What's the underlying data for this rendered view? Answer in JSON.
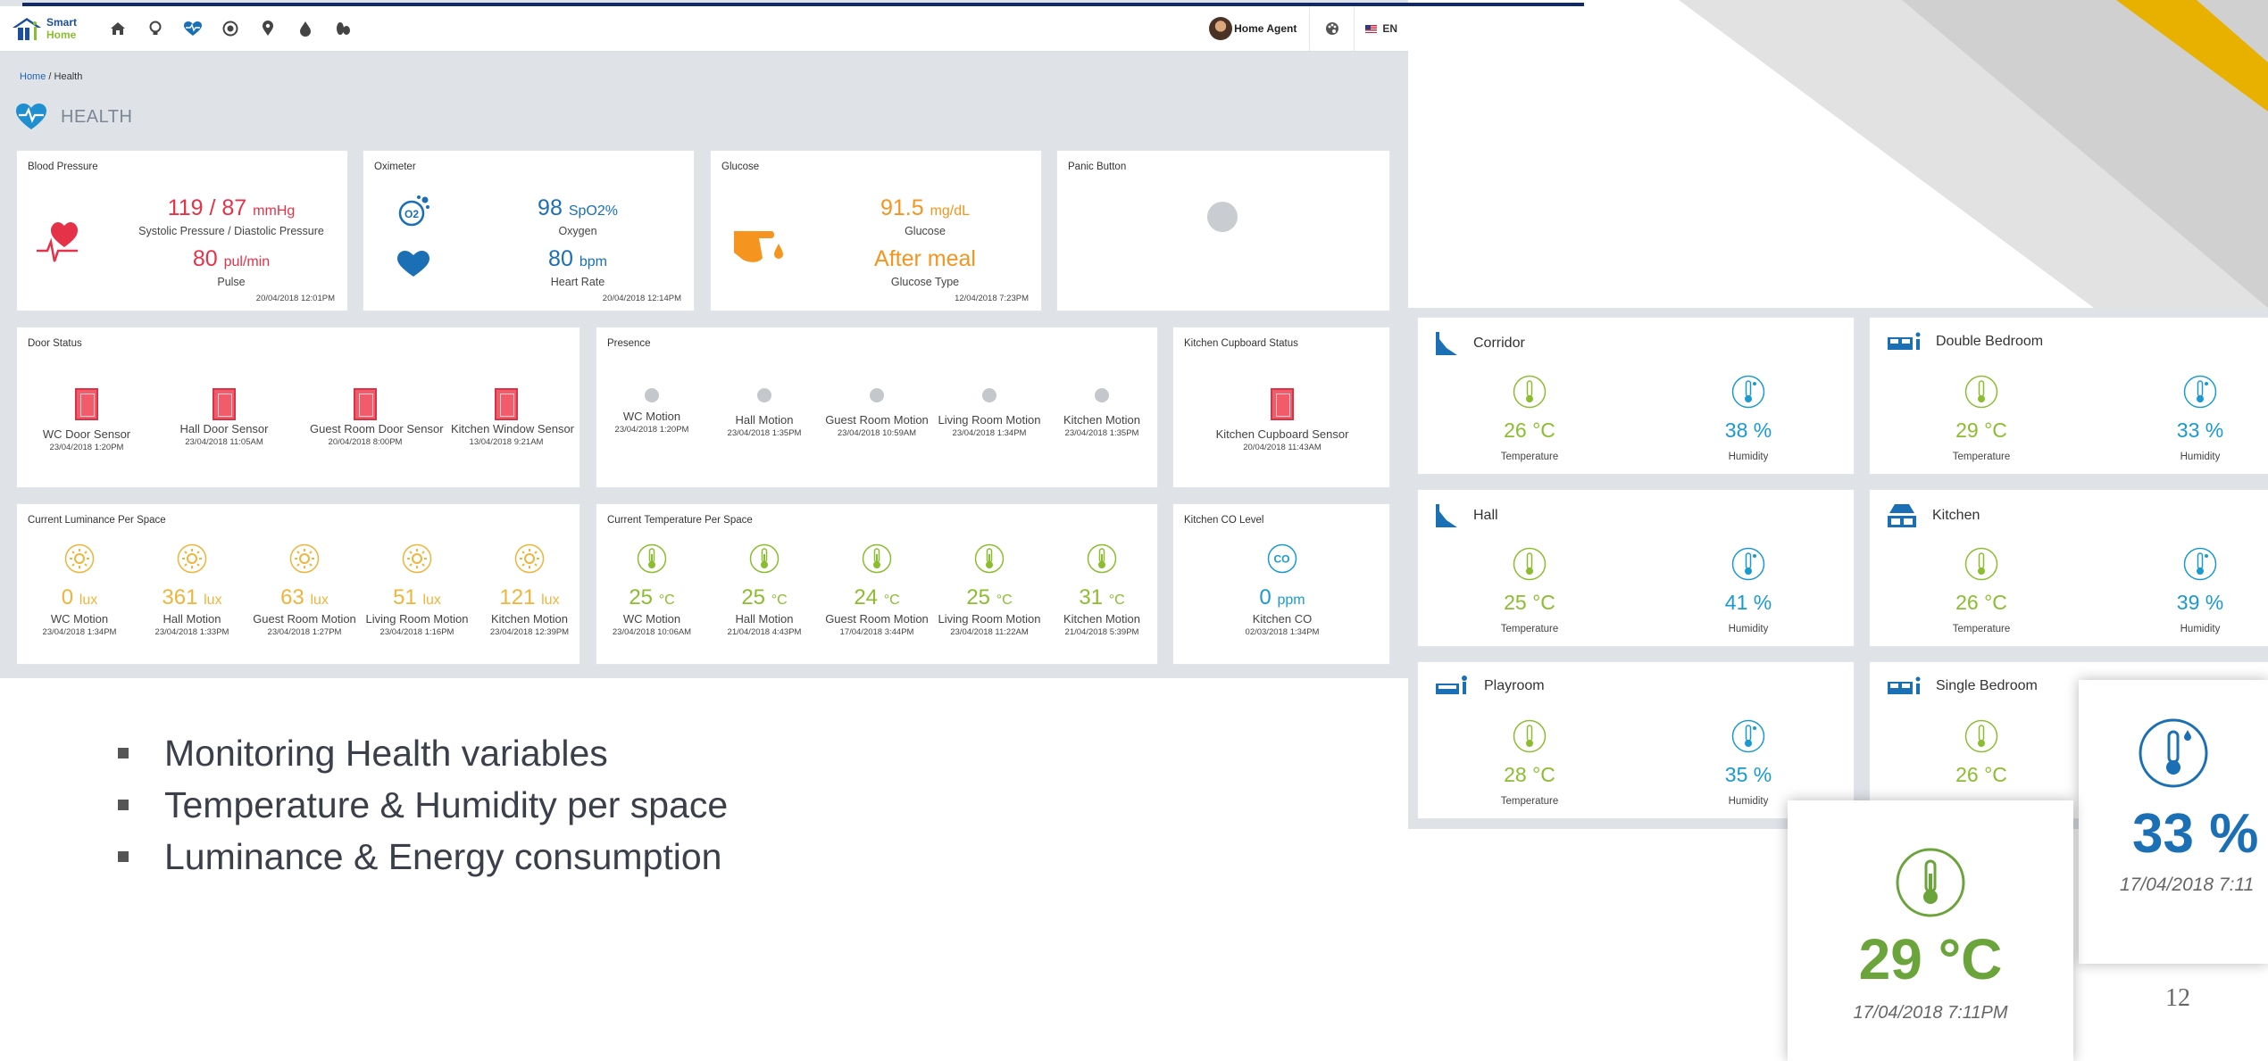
{
  "brand": {
    "line1": "Smart",
    "line2": "Home"
  },
  "nav_icons": [
    "home-icon",
    "bulb-icon",
    "heart-pulse-icon",
    "energy-icon",
    "location-pin-icon",
    "water-drop-icon",
    "leaf-icon"
  ],
  "header": {
    "user_name": "Home Agent",
    "language": "EN"
  },
  "breadcrumb": {
    "home": "Home",
    "separator": "/",
    "current": "Health"
  },
  "page_title": "HEALTH",
  "blood_pressure": {
    "title": "Blood Pressure",
    "value": "119 / 87",
    "unit": "mmHg",
    "label": "Systolic Pressure / Diastolic Pressure",
    "pulse_value": "80",
    "pulse_unit": "pul/min",
    "pulse_label": "Pulse",
    "timestamp": "20/04/2018 12:01PM"
  },
  "oximeter": {
    "title": "Oximeter",
    "oxygen_value": "98",
    "oxygen_unit": "SpO2%",
    "oxygen_label": "Oxygen",
    "hr_value": "80",
    "hr_unit": "bpm",
    "hr_label": "Heart Rate",
    "timestamp": "20/04/2018 12:14PM"
  },
  "glucose": {
    "title": "Glucose",
    "value": "91.5",
    "unit": "mg/dL",
    "label": "Glucose",
    "type_value": "After meal",
    "type_label": "Glucose Type",
    "timestamp": "12/04/2018 7:23PM"
  },
  "panic": {
    "title": "Panic Button"
  },
  "door_status": {
    "title": "Door Status",
    "sensors": [
      {
        "name": "WC Door Sensor",
        "ts": "23/04/2018 1:20PM"
      },
      {
        "name": "Hall Door Sensor",
        "ts": "23/04/2018 11:05AM"
      },
      {
        "name": "Guest Room Door Sensor",
        "ts": "20/04/2018 8:00PM"
      },
      {
        "name": "Kitchen Window Sensor",
        "ts": "13/04/2018 9:21AM"
      }
    ]
  },
  "presence": {
    "title": "Presence",
    "sensors": [
      {
        "name": "WC Motion",
        "ts": "23/04/2018 1:20PM"
      },
      {
        "name": "Hall Motion",
        "ts": "23/04/2018 1:35PM"
      },
      {
        "name": "Guest Room Motion",
        "ts": "23/04/2018 10:59AM"
      },
      {
        "name": "Living Room Motion",
        "ts": "23/04/2018 1:34PM"
      },
      {
        "name": "Kitchen Motion",
        "ts": "23/04/2018 1:35PM"
      }
    ]
  },
  "cupboard": {
    "title": "Kitchen Cupboard Status",
    "name": "Kitchen Cupboard Sensor",
    "ts": "20/04/2018 11:43AM"
  },
  "luminance": {
    "title": "Current Luminance Per Space",
    "unit": "lux",
    "sensors": [
      {
        "value": "0",
        "name": "WC Motion",
        "ts": "23/04/2018 1:34PM"
      },
      {
        "value": "361",
        "name": "Hall Motion",
        "ts": "23/04/2018 1:33PM"
      },
      {
        "value": "63",
        "name": "Guest Room Motion",
        "ts": "23/04/2018 1:27PM"
      },
      {
        "value": "51",
        "name": "Living Room Motion",
        "ts": "23/04/2018 1:16PM"
      },
      {
        "value": "121",
        "name": "Kitchen Motion",
        "ts": "23/04/2018 12:39PM"
      }
    ]
  },
  "temperature": {
    "title": "Current Temperature Per Space",
    "unit": "°C",
    "sensors": [
      {
        "value": "25",
        "name": "WC Motion",
        "ts": "23/04/2018 10:06AM"
      },
      {
        "value": "25",
        "name": "Hall Motion",
        "ts": "21/04/2018 4:43PM"
      },
      {
        "value": "24",
        "name": "Guest Room Motion",
        "ts": "17/04/2018 3:44PM"
      },
      {
        "value": "25",
        "name": "Living Room Motion",
        "ts": "23/04/2018 11:22AM"
      },
      {
        "value": "31",
        "name": "Kitchen Motion",
        "ts": "21/04/2018 5:39PM"
      }
    ]
  },
  "co": {
    "title": "Kitchen CO Level",
    "value": "0",
    "unit": "ppm",
    "name": "Kitchen CO",
    "ts": "02/03/2018 1:34PM"
  },
  "rooms": [
    {
      "name": "Corridor",
      "icon": "corridor-icon",
      "temp": "26 °C",
      "hum": "38 %",
      "temp_label": "Temperature",
      "hum_label": "Humidity"
    },
    {
      "name": "Double Bedroom",
      "icon": "double-bed-icon",
      "temp": "29 °C",
      "hum": "33 %",
      "temp_label": "Temperature",
      "hum_label": "Humidity"
    },
    {
      "name": "Hall",
      "icon": "hall-icon",
      "temp": "25 °C",
      "hum": "41 %",
      "temp_label": "Temperature",
      "hum_label": "Humidity"
    },
    {
      "name": "Kitchen",
      "icon": "kitchen-icon",
      "temp": "26 °C",
      "hum": "39 %",
      "temp_label": "Temperature",
      "hum_label": "Humidity"
    },
    {
      "name": "Playroom",
      "icon": "playroom-icon",
      "temp": "28 °C",
      "hum": "35 %",
      "temp_label": "Temperature",
      "hum_label": "Humidity"
    },
    {
      "name": "Single Bedroom",
      "icon": "single-bed-icon",
      "temp": "26 °C",
      "hum": "",
      "temp_label": "",
      "hum_label": ""
    }
  ],
  "bullets": [
    "Monitoring Health variables",
    "Temperature & Humidity per space",
    "Luminance & Energy consumption"
  ],
  "zoom_temp": {
    "value": "29 °C",
    "ts": "17/04/2018 7:11PM"
  },
  "zoom_hum": {
    "value": "33 %",
    "ts": "17/04/2018 7:11"
  },
  "page_number": "12",
  "colors": {
    "navy": "#0e2a6b",
    "red": "#e63248",
    "blue": "#1a6fb5",
    "orange": "#f5941f",
    "yellow": "#f0b43a",
    "green": "#8bbd2f",
    "teal": "#1a9ad0",
    "deco_grey": "#d4d4d4",
    "deco_yellow": "#e8b100"
  }
}
